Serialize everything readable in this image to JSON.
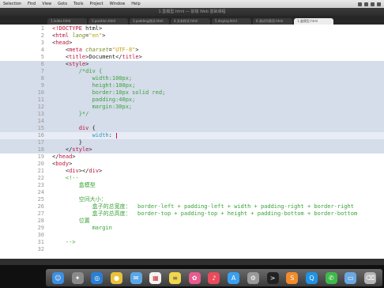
{
  "menubar": {
    "items": [
      "Selection",
      "Find",
      "View",
      "Goto",
      "Tools",
      "Project",
      "Window",
      "Help"
    ]
  },
  "window": {
    "title": "1.盒模型.html — 前端 Web 基础课程"
  },
  "tabs": [
    {
      "label": "1.index.html"
    },
    {
      "label": "2.position.html"
    },
    {
      "label": "3.padding测试.html"
    },
    {
      "label": "4.文本样式.html"
    },
    {
      "label": "5.display.html"
    },
    {
      "label": "6.测试列表项.html"
    },
    {
      "label": "1.盒模型.html",
      "active": true
    }
  ],
  "colors": {
    "selection": "#d5dcea",
    "tag": "#c0153b",
    "comment": "#3aa33a",
    "property": "#2c96c4"
  },
  "code": {
    "line_numbers": [
      "1",
      "2",
      "3",
      "4",
      "5",
      "6",
      "7",
      "8",
      "9",
      "10",
      "11",
      "12",
      "13",
      "14",
      "15",
      "16",
      "17",
      "18",
      "19",
      "20",
      "21",
      "22",
      "23",
      "24",
      "25",
      "26",
      "27",
      "28",
      "29",
      "30",
      "31",
      "32"
    ],
    "comment_title": "盒模型",
    "space_size_label": "空间大小：",
    "total_width_label": "盒子的总宽度：",
    "total_width_formula": "border-left + padding-left + width + padding-right + border-right",
    "total_height_label": "盒子的总高度：",
    "total_height_formula": "border-top + padding-top + height + padding-bottom + border-bottom",
    "position_label": "位置",
    "margin_label": "margin"
  },
  "dock": {
    "icons": [
      "finder-icon",
      "launchpad-icon",
      "safari-icon",
      "chrome-icon",
      "mail-icon",
      "calendar-icon",
      "notes-icon",
      "photos-icon",
      "music-icon",
      "appstore-icon",
      "settings-icon",
      "terminal-icon",
      "sublime-icon",
      "qq-icon",
      "wechat-icon",
      "folder-icon",
      "trash-icon"
    ]
  }
}
